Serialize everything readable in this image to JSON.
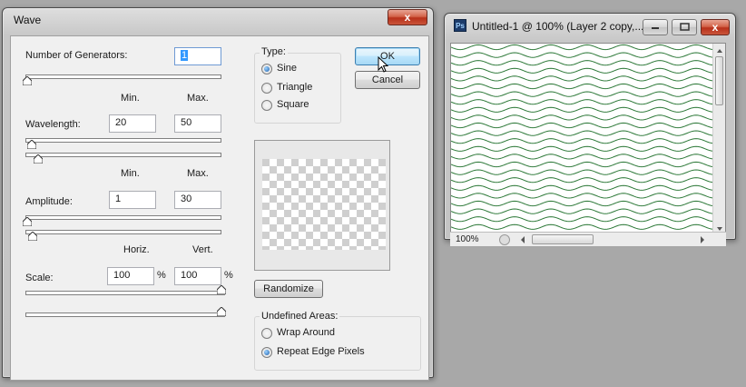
{
  "wave_dialog": {
    "title": "Wave",
    "close_label": "x",
    "generators": {
      "label": "Number of Generators:",
      "value": "1"
    },
    "headers": {
      "min": "Min.",
      "max": "Max.",
      "horiz": "Horiz.",
      "vert": "Vert."
    },
    "wavelength": {
      "label": "Wavelength:",
      "min": "20",
      "max": "50"
    },
    "amplitude": {
      "label": "Amplitude:",
      "min": "1",
      "max": "30"
    },
    "scale": {
      "label": "Scale:",
      "horiz": "100",
      "vert": "100",
      "unit": "%"
    },
    "type": {
      "label": "Type:",
      "options": [
        "Sine",
        "Triangle",
        "Square"
      ],
      "selected": "Sine"
    },
    "ok_label": "OK",
    "cancel_label": "Cancel",
    "randomize_label": "Randomize",
    "undefined_areas": {
      "label": "Undefined Areas:",
      "options": [
        "Wrap Around",
        "Repeat Edge Pixels"
      ],
      "selected": "Repeat Edge Pixels"
    }
  },
  "document_window": {
    "app_icon_text": "Ps",
    "title": "Untitled-1 @ 100% (Layer 2 copy,...",
    "close_label": "x",
    "zoom": "100%",
    "wave_color": "#2f7a3a"
  }
}
